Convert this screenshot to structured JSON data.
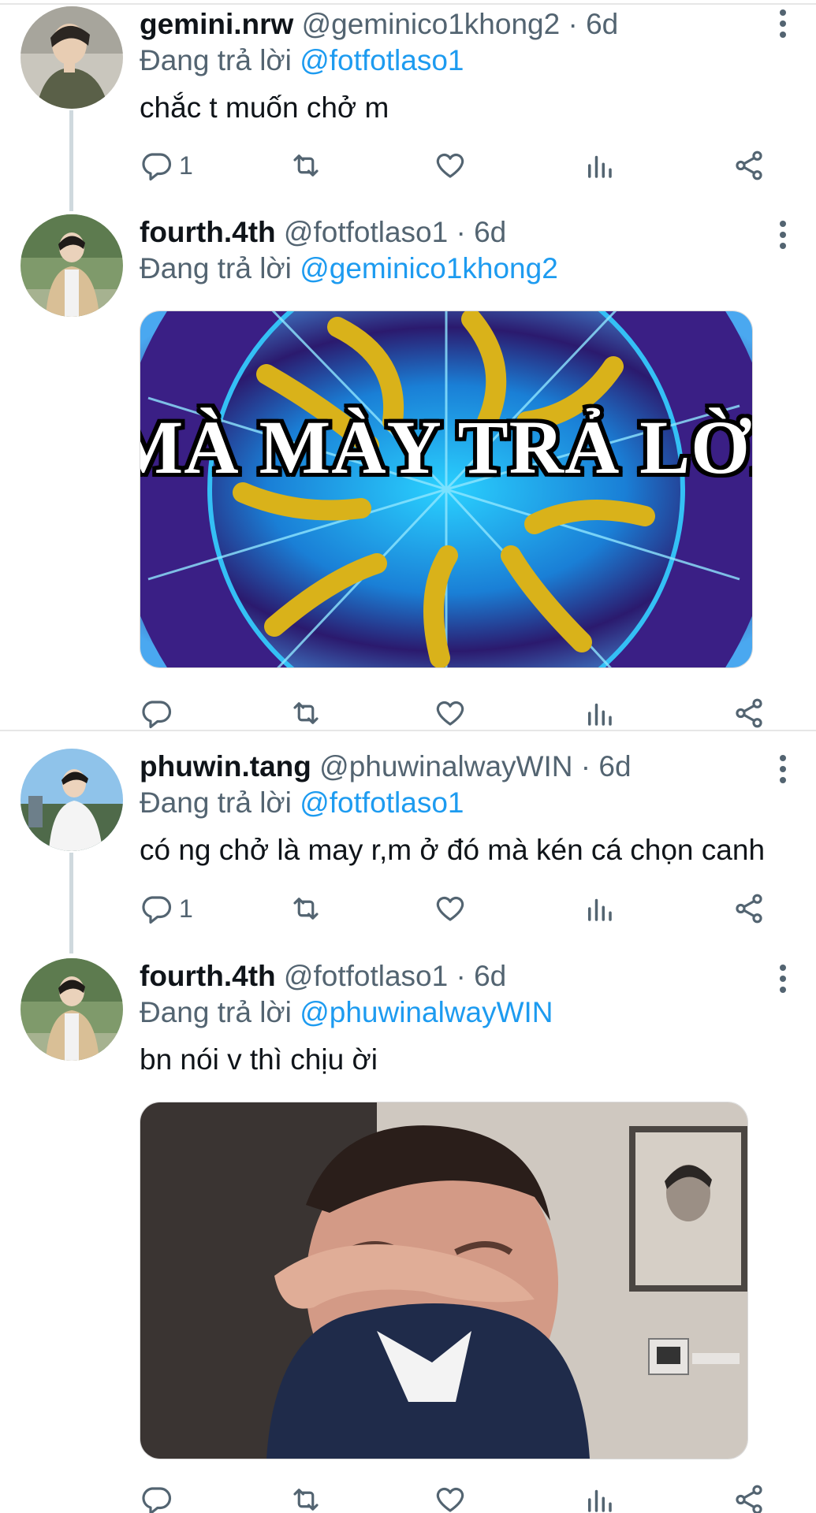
{
  "tweets": [
    {
      "name": "gemini.nrw",
      "handle": "@geminico1khong2",
      "time": "· 6d",
      "reply_prefix": "Đang trả lời",
      "reply_to": "@fotfotlaso1",
      "text": "chắc t muốn chở m",
      "reply_count": "1"
    },
    {
      "name": "fourth.4th",
      "handle": "@fotfotlaso1",
      "time": "· 6d",
      "reply_prefix": "Đang trả lời",
      "reply_to": "@geminico1khong2",
      "media_caption": "MÀ MÀY TRẢ LỜI"
    },
    {
      "name": "phuwin.tang",
      "handle": "@phuwinalwayWIN",
      "time": "· 6d",
      "reply_prefix": "Đang trả lời",
      "reply_to": "@fotfotlaso1",
      "text": "có ng chở là may r,m ở đó mà kén cá chọn canh",
      "reply_count": "1"
    },
    {
      "name": "fourth.4th",
      "handle": "@fotfotlaso1",
      "time": "· 6d",
      "reply_prefix": "Đang trả lời",
      "reply_to": "@phuwinalwayWIN",
      "text": "bn nói v thì chịu ời"
    }
  ],
  "colors": {
    "mention": "#1d9bf0",
    "secondary_text": "#536471",
    "primary_text": "#0f1419",
    "thread_line": "#cfd9de"
  },
  "icons": [
    "reply-icon",
    "retweet-icon",
    "like-icon",
    "analytics-icon",
    "share-icon",
    "more-icon"
  ]
}
